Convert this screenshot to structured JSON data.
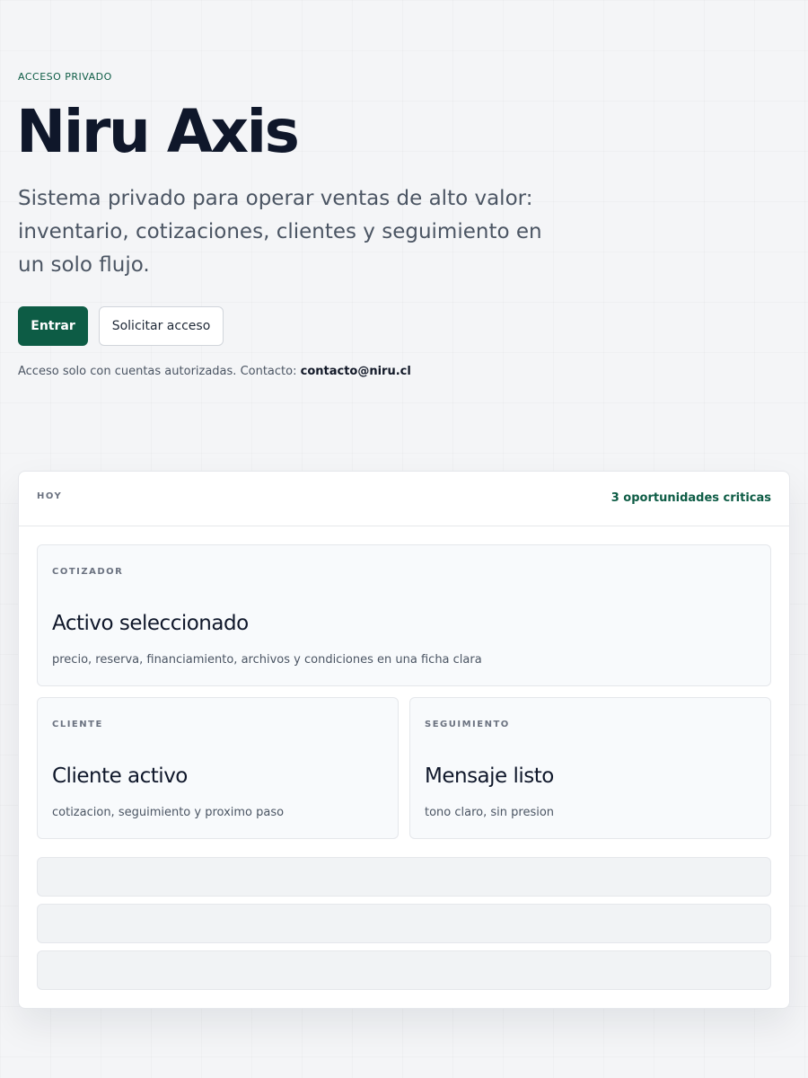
{
  "hero": {
    "eyebrow": "ACCESO PRIVADO",
    "title": "Niru Axis",
    "subtitle": "Sistema privado para operar ventas de alto valor: inventario, cotizaciones, clientes y seguimiento en un solo flujo.",
    "primary_button": "Entrar",
    "secondary_button": "Solicitar acceso",
    "note_text": "Acceso solo con cuentas autorizadas. Contacto: ",
    "note_email": "contacto@niru.cl"
  },
  "dashboard": {
    "label": "HOY",
    "status": "3 oportunidades criticas",
    "panels": [
      {
        "label": "COTIZADOR",
        "title": "Activo seleccionado",
        "description": "precio, reserva, financiamiento, archivos y condiciones en una ficha clara"
      },
      {
        "label": "CLIENTE",
        "title": "Cliente activo",
        "description": "cotizacion, seguimiento y proximo paso"
      },
      {
        "label": "SEGUIMIENTO",
        "title": "Mensaje listo",
        "description": "tono claro, sin presion"
      }
    ]
  },
  "colors": {
    "accent": "#0d5c45",
    "background": "#f4f5f7",
    "text_primary": "#0f172a",
    "text_secondary": "#4b5563"
  }
}
